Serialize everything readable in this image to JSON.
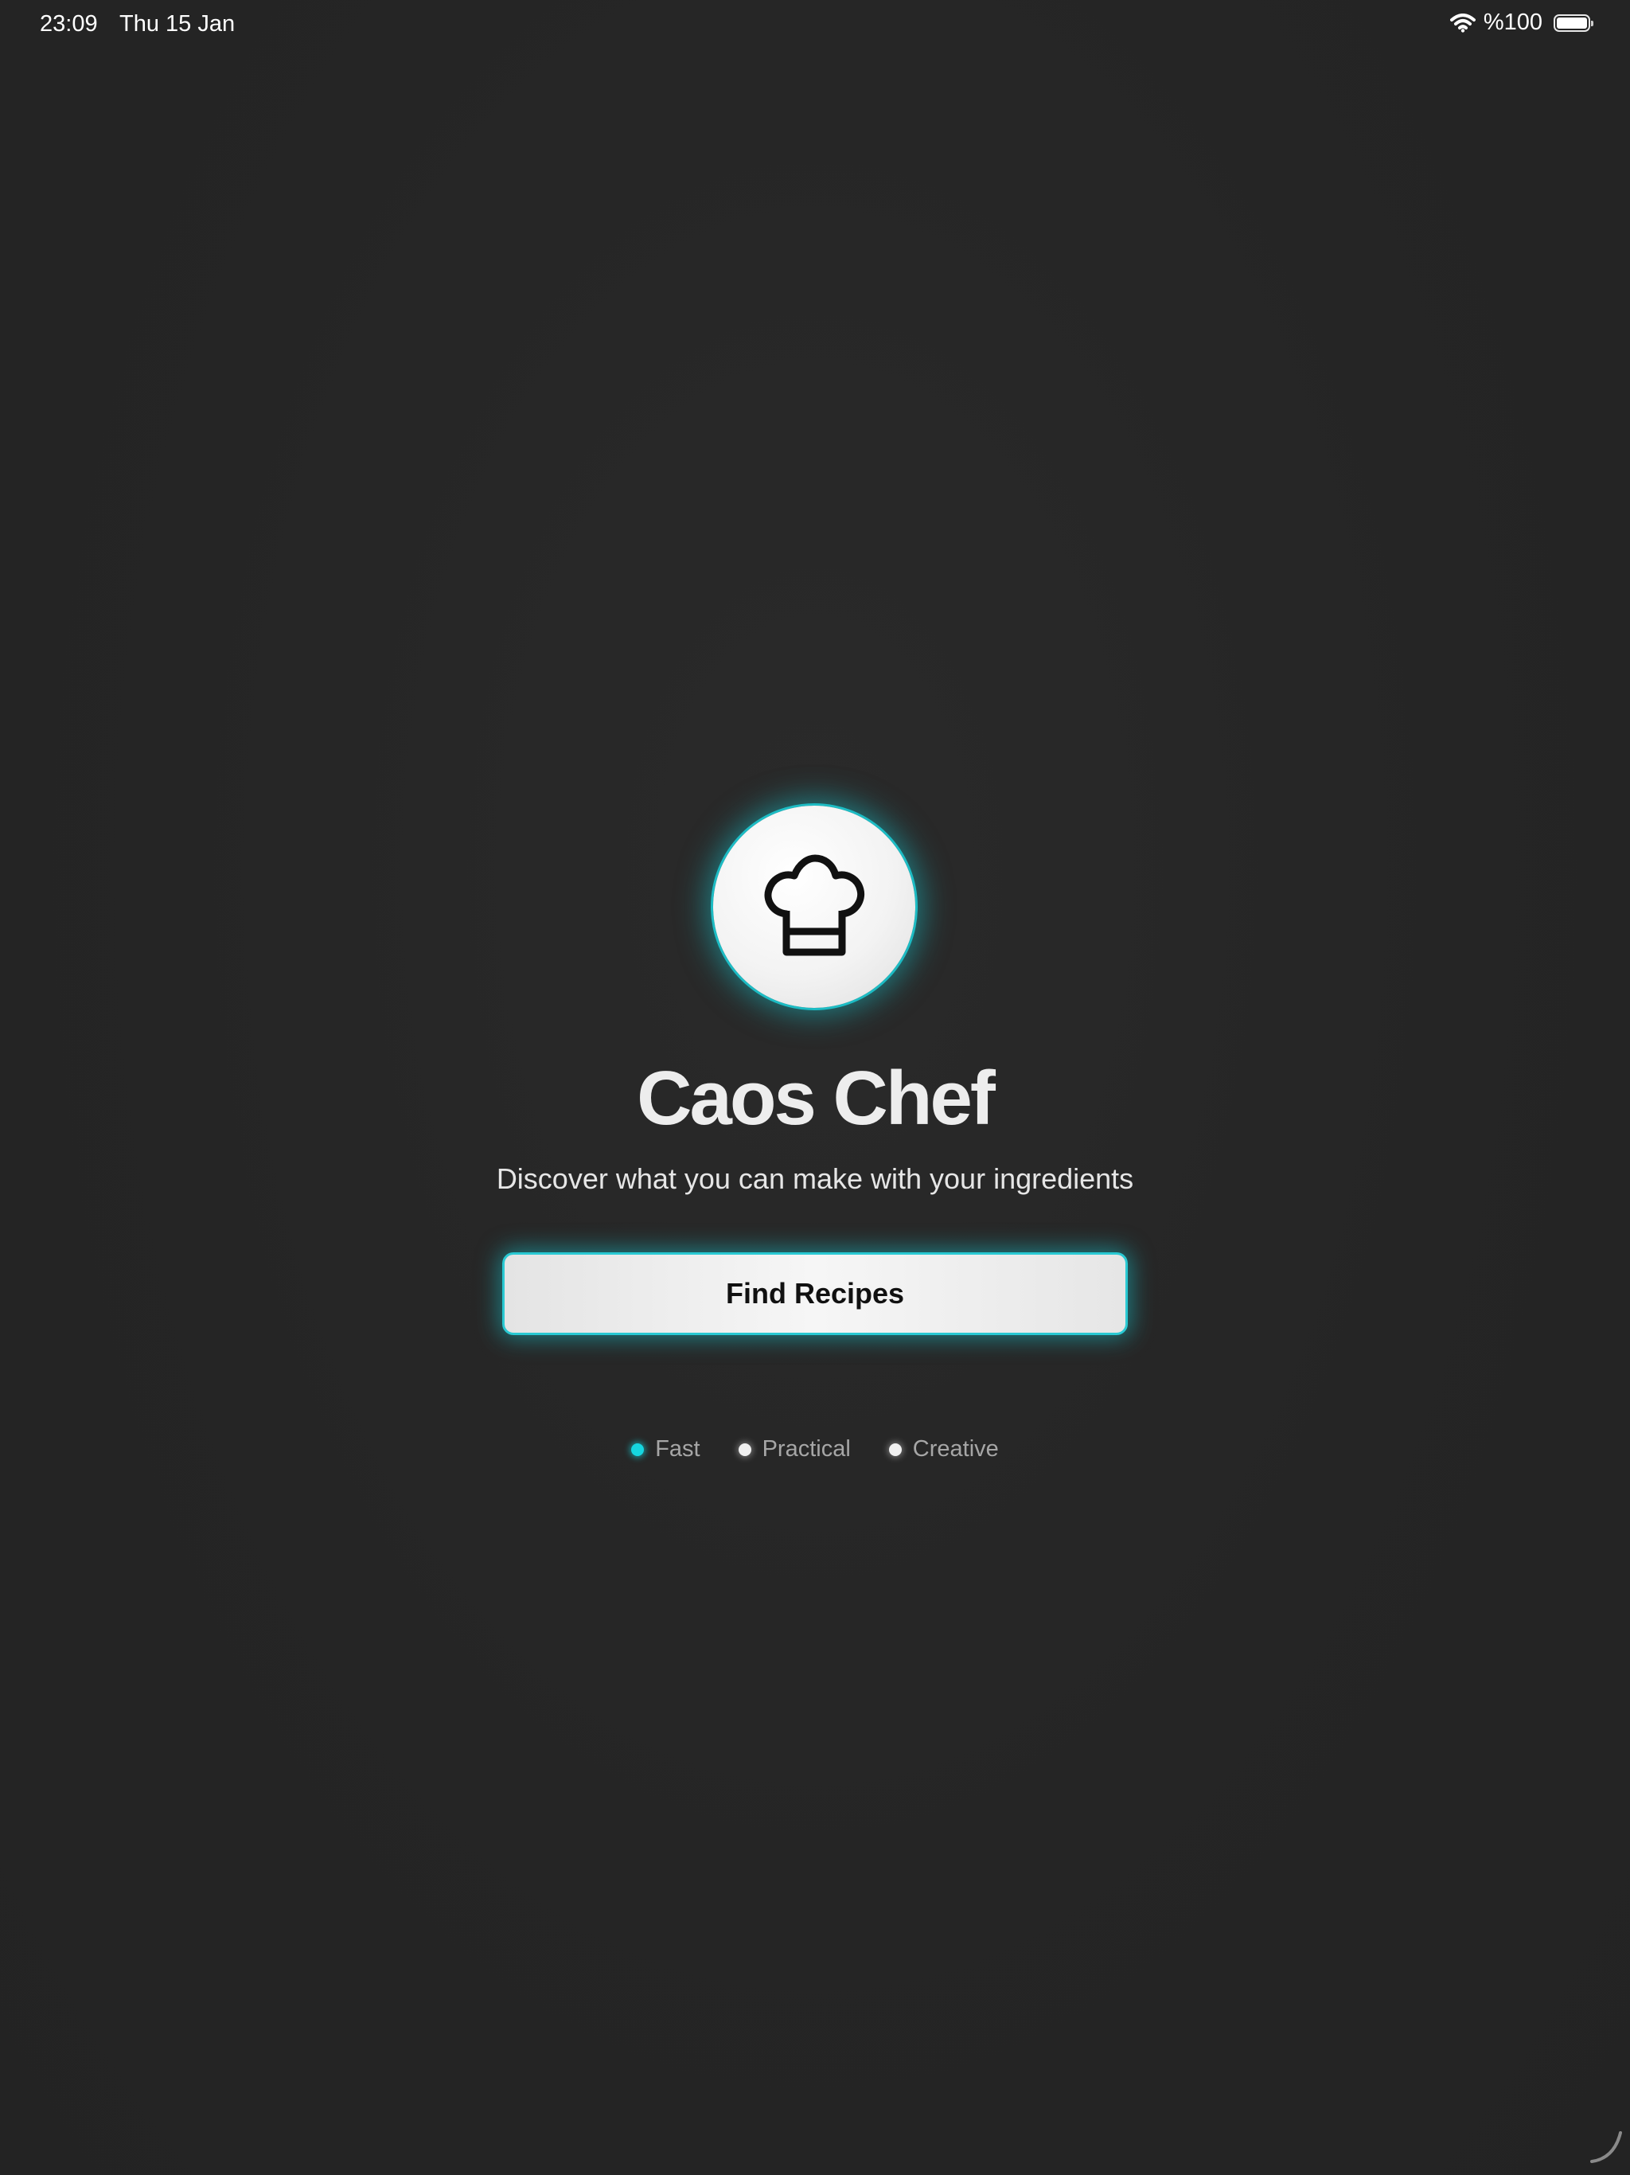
{
  "status_bar": {
    "time": "23:09",
    "date": "Thu 15 Jan",
    "battery_percent": "%100",
    "icons": [
      "wifi-icon",
      "battery-icon"
    ]
  },
  "logo": {
    "icon": "chef-hat-icon"
  },
  "title": "Caos Chef",
  "subtitle": "Discover what you can make with your ingredients",
  "primary_button": {
    "label": "Find Recipes"
  },
  "features": [
    {
      "label": "Fast",
      "dot_color": "#16d6e0"
    },
    {
      "label": "Practical",
      "dot_color": "#f0f0f0"
    },
    {
      "label": "Creative",
      "dot_color": "#f0f0f0"
    }
  ],
  "colors": {
    "background": "#262626",
    "accent": "#16d6e0",
    "title": "#ededed",
    "button_bg": "#f0f0f0",
    "button_text": "#111111",
    "tag_text": "#a6a6a6"
  }
}
